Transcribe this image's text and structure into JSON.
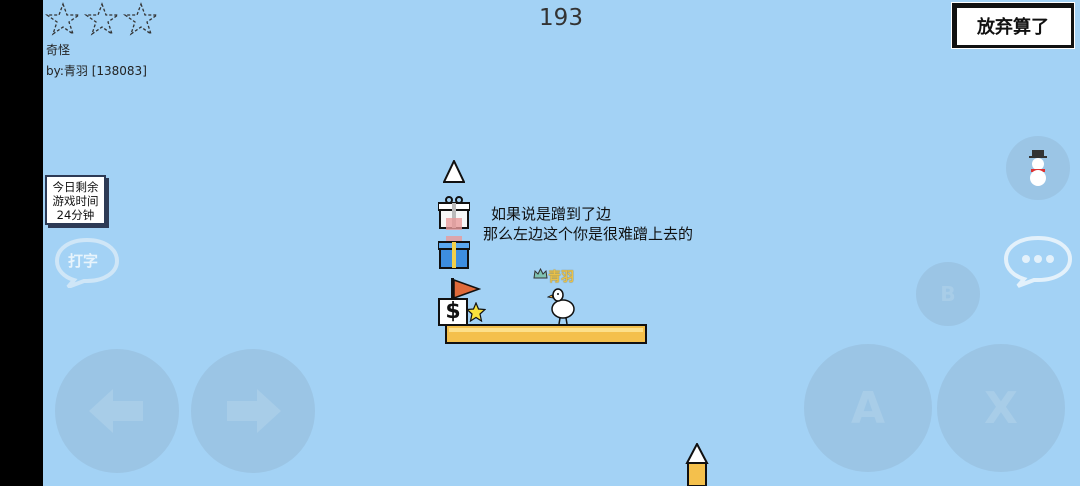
{
  "hud": {
    "rating_stars": 3,
    "level_name": "奇怪",
    "author": "by:青羽 [138083]",
    "timer": "193",
    "give_up_label": "放弃算了",
    "time_left_lines": [
      "今日剩余",
      "游戏时间",
      "24分钟"
    ],
    "type_label": "打字"
  },
  "controls": {
    "b_label": "B",
    "a_label": "A",
    "x_label": "X"
  },
  "scene": {
    "hint_line1": "如果说是蹭到了边",
    "hint_line2": "那么左边这个你是很难蹭上去的",
    "player_name": "青羽",
    "dollar": "$"
  },
  "colors": {
    "sky": "#a3d2f5",
    "platform": "#f4c04c",
    "flag": "#e06a3a",
    "gift_blue": "#3d8ee0",
    "star": "#f9e23c"
  },
  "icons": [
    "star-outline-icon",
    "snowman-icon",
    "chat-bubble-icon",
    "arrow-left-icon",
    "arrow-right-icon",
    "spike-icon",
    "gift-icon",
    "flag-icon",
    "duck-icon",
    "crown-icon"
  ]
}
